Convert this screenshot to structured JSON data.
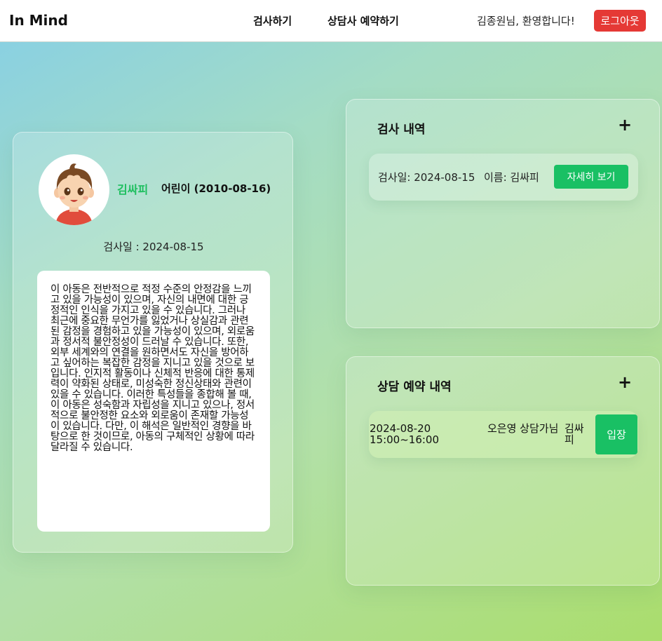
{
  "header": {
    "brand": "In Mind",
    "nav": [
      "검사하기",
      "상담사 예약하기"
    ],
    "welcome": "김종원님, 환영합니다!",
    "logout_label": "로그아웃"
  },
  "profile": {
    "name": "김싸피",
    "info": "어린이 (2010-08-16)",
    "exam_date": "검사일 : 2024-08-15",
    "result_text": "이 아동은 전반적으로 적정 수준의 안정감을 느끼고 있을 가능성이 있으며, 자신의 내면에 대한 긍정적인 인식을 가지고 있을 수 있습니다. 그러나 최근에 중요한 무언가를 잃었거나 상실감과 관련된 감정을 경험하고 있을 가능성이 있으며, 외로움과 정서적 불안정성이 드러날 수 있습니다. 또한, 외부 세계와의 연결을 원하면서도 자신을 방어하고 싶어하는 복잡한 감정을 지니고 있을 것으로 보입니다. 인지적 활동이나 신체적 반응에 대한 통제력이 약화된 상태로, 미성숙한 정신상태와 관련이 있을 수 있습니다. 이러한 특성들을 종합해 볼 때, 이 아동은 성숙함과 자립성을 지니고 있으나, 정서적으로 불안정한 요소와 외로움이 존재할 가능성이 있습니다. 다만, 이 해석은 일반적인 경향을 바탕으로 한 것이므로, 아동의 구체적인 상황에 따라 달라질 수 있습니다."
  },
  "history": {
    "title": "검사 내역",
    "add": "+",
    "items": [
      {
        "date": "검사일: 2024-08-15",
        "name": "이름: 김싸피",
        "button": "자세히 보기"
      }
    ]
  },
  "reservations": {
    "title": "상담 예약 내역",
    "add": "+",
    "items": [
      {
        "datetime": "2024-08-20 15:00~16:00",
        "counselor": "오은영 상담가님",
        "child": "김싸피",
        "button": "입장"
      }
    ]
  },
  "colors": {
    "accent_green": "#19c064",
    "logout_red": "#e53935",
    "name_green": "#1fbf60"
  },
  "icons": {
    "avatar": "boy-avatar-icon",
    "add": "plus-icon"
  }
}
